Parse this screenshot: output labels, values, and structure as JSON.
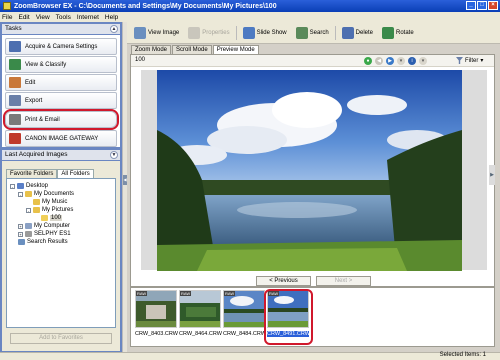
{
  "window": {
    "app_title": "ZoomBrowser EX",
    "path": "C:\\Documents and Settings\\My Documents\\My Pictures\\100",
    "minimize_label": "_",
    "maximize_label": "□",
    "close_label": "×"
  },
  "menu": [
    "File",
    "Edit",
    "View",
    "Tools",
    "Internet",
    "Help"
  ],
  "tasks": {
    "header": "Tasks",
    "items": [
      {
        "label": "Acquire & Camera Settings",
        "icon": "camera-icon",
        "color": "#4d6fb0"
      },
      {
        "label": "View & Classify",
        "icon": "view-classify-icon",
        "color": "#3a8a4a"
      },
      {
        "label": "Edit",
        "icon": "edit-icon",
        "color": "#c9783a"
      },
      {
        "label": "Export",
        "icon": "export-icon",
        "color": "#6a7fa8"
      },
      {
        "label": "Print & Email",
        "icon": "print-email-icon",
        "color": "#7a7a7a",
        "highlighted": true
      },
      {
        "label": "CANON IMAGE GATEWAY",
        "icon": "canon-gateway-icon",
        "color": "#c0392b"
      }
    ]
  },
  "last_acquired": {
    "header": "Last Acquired Images",
    "tabs": [
      {
        "label": "Favorite Folders",
        "active": false
      },
      {
        "label": "All Folders",
        "active": true
      }
    ],
    "tree": [
      {
        "label": "Desktop",
        "expander": "-",
        "icon": "desktop-icon"
      },
      {
        "label": "My Documents",
        "expander": "-",
        "icon": "folder-icon"
      },
      {
        "label": "My Music",
        "expander": "",
        "icon": "folder-icon"
      },
      {
        "label": "My Pictures",
        "expander": "-",
        "icon": "folder-icon"
      },
      {
        "label": "100",
        "expander": "",
        "icon": "folder-open-icon",
        "selected": true
      },
      {
        "label": "My Computer",
        "expander": "+",
        "icon": "computer-icon"
      },
      {
        "label": "SELPHY ES1",
        "expander": "+",
        "icon": "printer-icon"
      },
      {
        "label": "Search Results",
        "expander": "",
        "icon": "search-results-icon"
      }
    ],
    "add_favorites_label": "Add to Favorites"
  },
  "toolbar": {
    "buttons": [
      {
        "label": "View Image",
        "icon": "view-image-icon",
        "enabled": true
      },
      {
        "label": "Properties",
        "icon": "properties-icon",
        "enabled": false
      },
      {
        "label": "Slide Show",
        "icon": "slide-show-icon",
        "enabled": true
      },
      {
        "label": "Search",
        "icon": "search-icon",
        "enabled": true
      },
      {
        "label": "Delete",
        "icon": "delete-icon",
        "enabled": true
      },
      {
        "label": "Rotate",
        "icon": "rotate-icon",
        "enabled": true
      }
    ]
  },
  "view_modes": {
    "tabs": [
      {
        "label": "Zoom Mode",
        "active": false
      },
      {
        "label": "Scroll Mode",
        "active": false
      },
      {
        "label": "Preview Mode",
        "active": true
      }
    ]
  },
  "viewer": {
    "zoom_level": "100",
    "filter_label": "Filter",
    "previous_label": "< Previous",
    "next_label": "Next >",
    "next_enabled": false
  },
  "thumbnails": [
    {
      "label": "CRW_8403.CRW",
      "badge": "RAW",
      "selected": false
    },
    {
      "label": "CRW_8464.CRW",
      "badge": "RAW",
      "selected": false
    },
    {
      "label": "CRW_8484.CRW",
      "badge": "RAW",
      "selected": false
    },
    {
      "label": "CRW_8491.CRW",
      "badge": "RAW",
      "selected": true
    }
  ],
  "status": {
    "selected_text": "Selected Items: 1"
  }
}
